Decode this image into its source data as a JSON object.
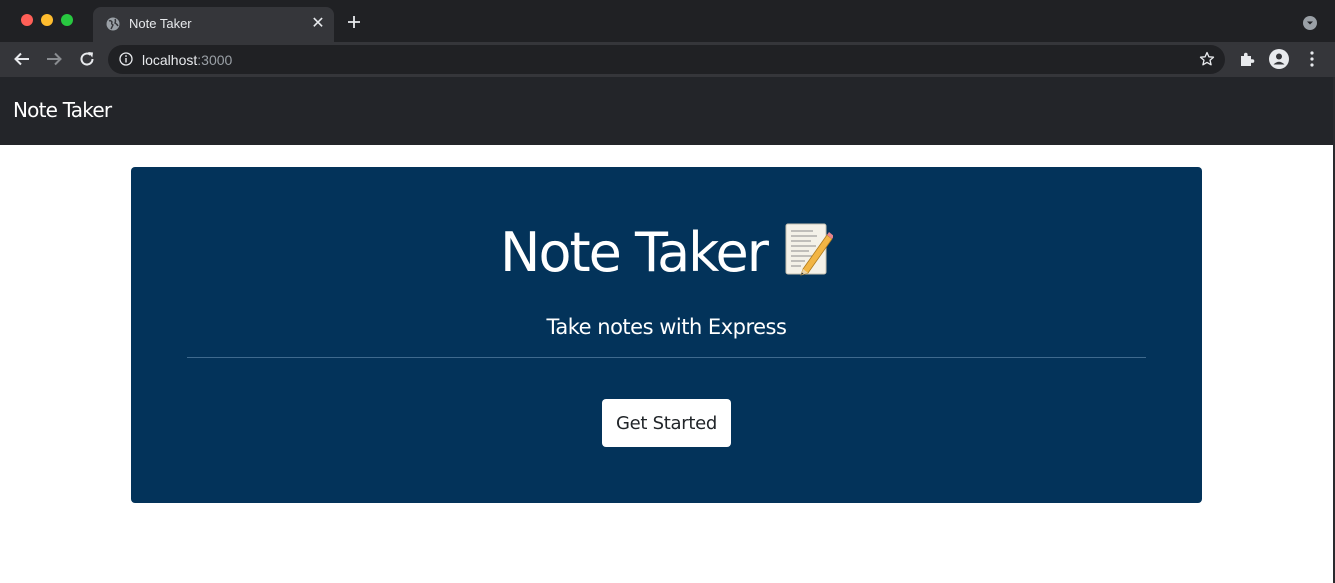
{
  "browser": {
    "tab_title": "Note Taker",
    "url_host": "localhost",
    "url_port": ":3000"
  },
  "navbar": {
    "brand": "Note Taker"
  },
  "hero": {
    "title": "Note Taker",
    "title_emoji": "📝",
    "subtitle": "Take notes with Express",
    "cta_label": "Get Started"
  },
  "colors": {
    "hero_background": "#03335a",
    "navbar_background": "#232529",
    "cta_background": "#ffffff"
  }
}
